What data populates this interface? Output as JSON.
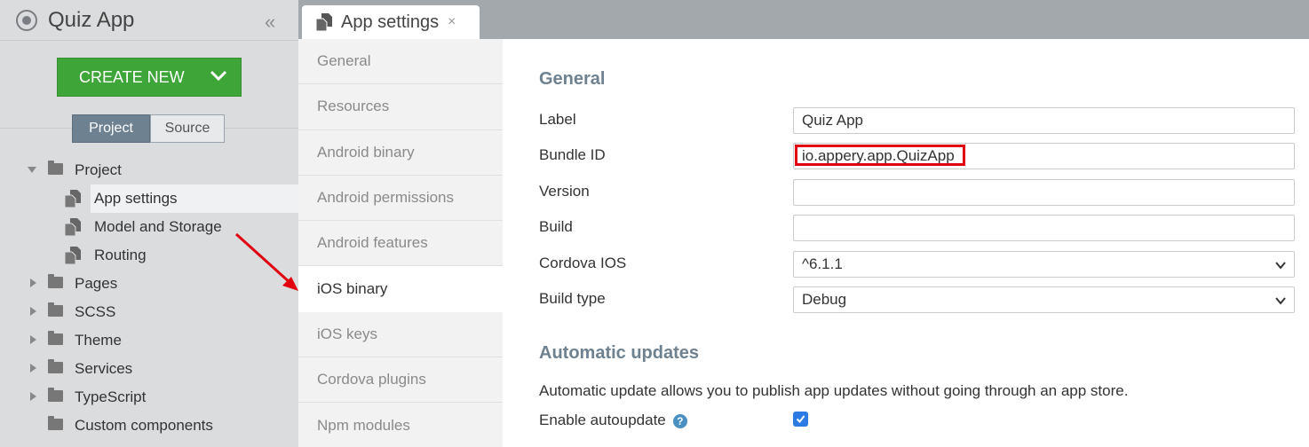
{
  "app": {
    "title": "Quiz App"
  },
  "sidebar": {
    "create_button": "CREATE NEW",
    "segments": [
      "Project",
      "Source"
    ],
    "tree": [
      {
        "label": "Project",
        "type": "folder",
        "expanded": true
      },
      {
        "label": "App settings",
        "type": "doc",
        "selected": true
      },
      {
        "label": "Model and Storage",
        "type": "doc"
      },
      {
        "label": "Routing",
        "type": "doc"
      },
      {
        "label": "Pages",
        "type": "folder"
      },
      {
        "label": "SCSS",
        "type": "folder"
      },
      {
        "label": "Theme",
        "type": "folder"
      },
      {
        "label": "Services",
        "type": "folder"
      },
      {
        "label": "TypeScript",
        "type": "folder"
      },
      {
        "label": "Custom components",
        "type": "folder"
      }
    ]
  },
  "tab": {
    "label": "App settings",
    "close": "×"
  },
  "subnav": [
    "General",
    "Resources",
    "Android binary",
    "Android permissions",
    "Android features",
    "iOS binary",
    "iOS keys",
    "Cordova plugins",
    "Npm modules"
  ],
  "subnav_active": "iOS binary",
  "form": {
    "general_title": "General",
    "label_label": "Label",
    "label_value": "Quiz App",
    "bundle_label": "Bundle ID",
    "bundle_value": "io.appery.app.QuizApp",
    "version_label": "Version",
    "version_value": "",
    "build_label": "Build",
    "build_value": "",
    "cordova_label": "Cordova IOS",
    "cordova_value": "^6.1.1",
    "buildtype_label": "Build type",
    "buildtype_value": "Debug",
    "updates_title": "Automatic updates",
    "updates_desc": "Automatic update allows you to publish app updates without going through an app store.",
    "autoupdate_label": "Enable autoupdate",
    "autoupdate_checked": true
  },
  "colors": {
    "accent": "#6d8191",
    "create_green": "#3ea538",
    "highlight": "#e0000f",
    "checkbox": "#2c7be5"
  }
}
